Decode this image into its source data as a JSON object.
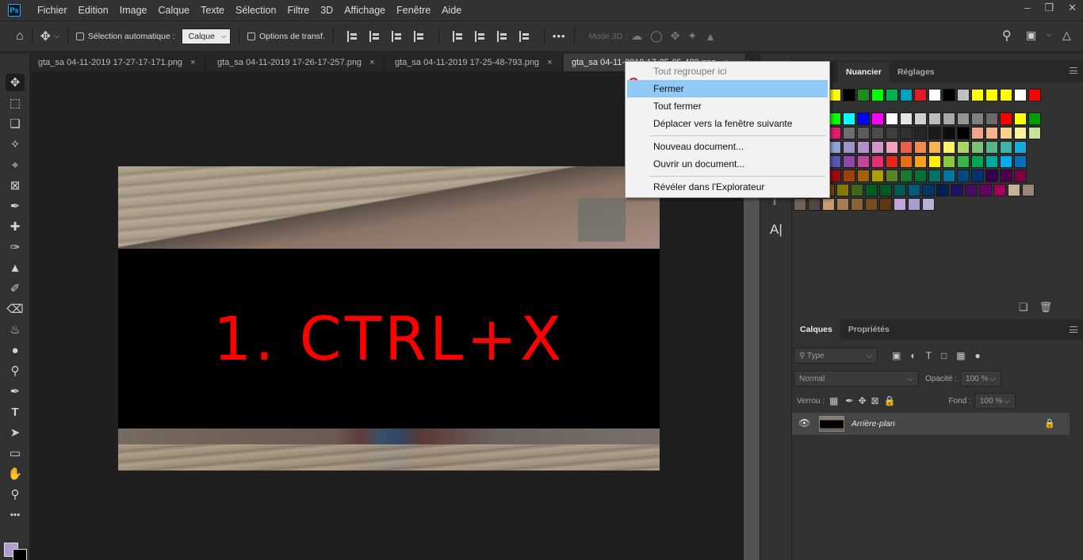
{
  "menubar": {
    "logo": "Ps",
    "items": [
      "Fichier",
      "Edition",
      "Image",
      "Calque",
      "Texte",
      "Sélection",
      "Filtre",
      "3D",
      "Affichage",
      "Fenêtre",
      "Aide"
    ]
  },
  "optionsbar": {
    "auto_select_label": "Sélection automatique :",
    "auto_select_value": "Calque",
    "transform_label": "Options de transf.",
    "more": "•••",
    "mode3d_label": "Mode 3D :"
  },
  "tabs": [
    {
      "label": "gta_sa 04-11-2019 17-27-17-171.png",
      "close": "×"
    },
    {
      "label": "gta_sa 04-11-2019 17-26-17-257.png",
      "close": "×"
    },
    {
      "label": "gta_sa 04-11-2019 17-25-48-793.png",
      "close": "×"
    },
    {
      "label": "gta_sa 04-11-2019 17-25-05-489.png",
      "close": "×"
    }
  ],
  "tabs_overflow": "»",
  "canvas": {
    "overlay_text": "1. CTRL+X"
  },
  "context_menu": {
    "step_marker": "2",
    "items": {
      "regroup": "Tout regrouper ici",
      "close": "Fermer",
      "close_all": "Tout fermer",
      "move_next": "Déplacer vers la fenêtre suivante",
      "new_doc": "Nouveau document...",
      "open_doc": "Ouvrir un document...",
      "reveal": "Révéler dans l'Explorateur"
    }
  },
  "swatch_panel": {
    "tabs": [
      "Nuancier",
      "Réglages"
    ],
    "colors": {
      "row1": [
        "#ffff00",
        "#000000",
        "#1e8c1e",
        "#00ff00",
        "#00b050",
        "#00a0c0",
        "#e01b24",
        "#ffffff",
        "#000000",
        "#c0c0c0",
        "#ffff00",
        "#ffff00",
        "#ffff00",
        "#ffffff",
        "#ff0000"
      ],
      "row2": [
        "#00ff00",
        "#00ffff",
        "#0000ff",
        "#ff00ff",
        "#ffffff",
        "#e6e6e6",
        "#d0d0d0",
        "#bdbdbd",
        "#a8a8a8",
        "#949494",
        "#808080",
        "#6b6b6b",
        "#ff0000",
        "#ffff00",
        "#00a000"
      ],
      "row3": [
        "#e01b70",
        "#6e6e6e",
        "#5b5b5b",
        "#4c4c4c",
        "#3e3e3e",
        "#323232",
        "#262626",
        "#1a1a1a",
        "#0d0d0d",
        "#000000",
        "#f4a38c",
        "#f7b48a",
        "#fbd38a",
        "#fff49c",
        "#c9e19a"
      ],
      "row4": [
        "#9ec3e8",
        "#8fa5d6",
        "#9d94cc",
        "#b48fcb",
        "#d396c9",
        "#f2a0c0",
        "#e8604c",
        "#ef8b4f",
        "#f9b253",
        "#fff36b",
        "#acd26e",
        "#7ac27a",
        "#58b58a",
        "#3fb3a6",
        "#17a9d9"
      ],
      "row5": [
        "#3f6fc9",
        "#5e55b2",
        "#8c4aa6",
        "#c4459e",
        "#e62e74",
        "#e8241b",
        "#ee6b12",
        "#f7a21b",
        "#fff200",
        "#8cc63f",
        "#39b54a",
        "#00a651",
        "#00a99d",
        "#00aeef",
        "#0072bc"
      ],
      "row6": [
        "#d6005c",
        "#9e0b0f",
        "#a0410d",
        "#a36209",
        "#aba000",
        "#598527",
        "#197b30",
        "#007236",
        "#00746b",
        "#0076a3",
        "#004a80",
        "#003471",
        "#32004b",
        "#4b0049",
        "#7b0046"
      ],
      "row7": [
        "#790000",
        "#7b2e00",
        "#7d4900",
        "#827b00",
        "#406618",
        "#005e20",
        "#005826",
        "#005952",
        "#005b7f",
        "#003663",
        "#002157",
        "#1b1464",
        "#440e62",
        "#630460",
        "#9e005d",
        "#c7b299",
        "#998675"
      ],
      "row8": [
        "#736357",
        "#534741",
        "#c69c6d",
        "#a67c52",
        "#8c6239",
        "#754c24",
        "#603913",
        "#c0a6d8",
        "#a59dd1",
        "#b3b3d6"
      ]
    }
  },
  "layers_panel": {
    "tabs": [
      "Calques",
      "Propriétés"
    ],
    "filter_placeholder": "Type",
    "blend_mode": "Normal",
    "opacity_label": "Opacité :",
    "opacity_value": "100 %",
    "lock_label": "Verrou :",
    "fill_label": "Fond :",
    "fill_value": "100 %",
    "layer_name": "Arrière-plan"
  },
  "icons": {
    "eye": "👁",
    "lock": "🔒",
    "home": "⌂",
    "move": "✥",
    "search": "⌕",
    "text_tool_dock": "A|"
  }
}
